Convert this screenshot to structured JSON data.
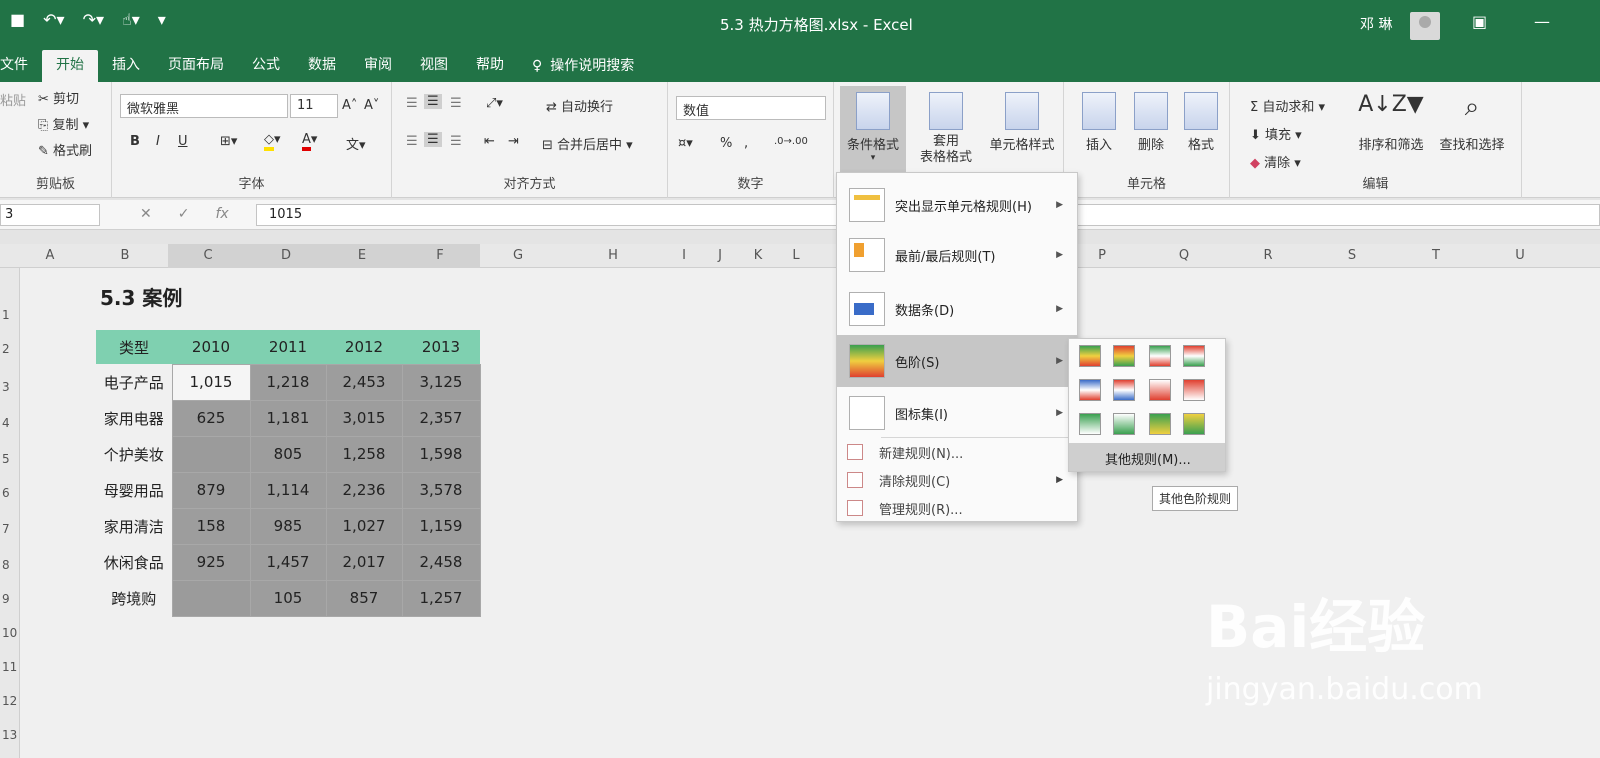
{
  "titlebar": {
    "title": "5.3 热力方格图.xlsx  -  Excel",
    "user": "邓 琳"
  },
  "tabs": [
    "文件",
    "开始",
    "插入",
    "页面布局",
    "公式",
    "数据",
    "审阅",
    "视图",
    "帮助"
  ],
  "search_tab": "操作说明搜索",
  "clipboard": {
    "cut": "剪切",
    "copy": "复制 ▾",
    "format_painter": "格式刷",
    "paste": "粘贴",
    "label": "剪贴板"
  },
  "font": {
    "name": "微软雅黑",
    "size": "11",
    "label": "字体",
    "bold": "B",
    "italic": "I",
    "underline": "U",
    "grow": "A˄",
    "shrink": "A˅"
  },
  "alignment": {
    "wrap": "自动换行",
    "merge": "合并后居中",
    "label": "对齐方式"
  },
  "number": {
    "format": "数值",
    "label": "数字",
    "percent": "%",
    "comma": ","
  },
  "styles": {
    "conditional": "条件格式",
    "table_format": "套用\n表格格式",
    "cell_styles": "单元格样式"
  },
  "cells": {
    "insert": "插入",
    "delete": "删除",
    "format": "格式",
    "label": "单元格"
  },
  "editing": {
    "autosum": "自动求和",
    "fill": "填充",
    "clear": "清除",
    "sort": "排序和筛选",
    "find": "查找和选择",
    "label": "编辑"
  },
  "formula_bar": {
    "name": "3",
    "value": "1015",
    "fx": "fx"
  },
  "columns": [
    "A",
    "B",
    "C",
    "D",
    "E",
    "F",
    "G",
    "H",
    "I",
    "J",
    "K",
    "L",
    "P",
    "Q",
    "R",
    "S",
    "T",
    "U"
  ],
  "rows": [
    "1",
    "2",
    "3",
    "4",
    "5",
    "6",
    "7",
    "8",
    "9",
    "10",
    "11",
    "12",
    "13"
  ],
  "sheet": {
    "heading": "5.3 案例",
    "header": [
      "类型",
      "2010",
      "2011",
      "2012",
      "2013"
    ],
    "table": [
      [
        "电子产品",
        "1,015",
        "1,218",
        "2,453",
        "3,125"
      ],
      [
        "家用电器",
        "625",
        "1,181",
        "3,015",
        "2,357"
      ],
      [
        "个护美妆",
        "",
        "805",
        "1,258",
        "1,598"
      ],
      [
        "母婴用品",
        "879",
        "1,114",
        "2,236",
        "3,578"
      ],
      [
        "家用清洁",
        "158",
        "985",
        "1,027",
        "1,159"
      ],
      [
        "休闲食品",
        "925",
        "1,457",
        "2,017",
        "2,458"
      ],
      [
        "跨境购",
        "",
        "105",
        "857",
        "1,257"
      ]
    ]
  },
  "menu": {
    "highlight": "突出显示单元格规则(H)",
    "topbottom": "最前/最后规则(T)",
    "databar": "数据条(D)",
    "colorscale": "色阶(S)",
    "iconset": "图标集(I)",
    "new_rule": "新建规则(N)...",
    "clear_rule": "清除规则(C)",
    "manage_rule": "管理规则(R)..."
  },
  "submenu": {
    "more": "其他规则(M)...",
    "tooltip": "其他色阶规则"
  },
  "watermark": {
    "brand": "Bai经验",
    "url": "jingyan.baidu.com"
  }
}
